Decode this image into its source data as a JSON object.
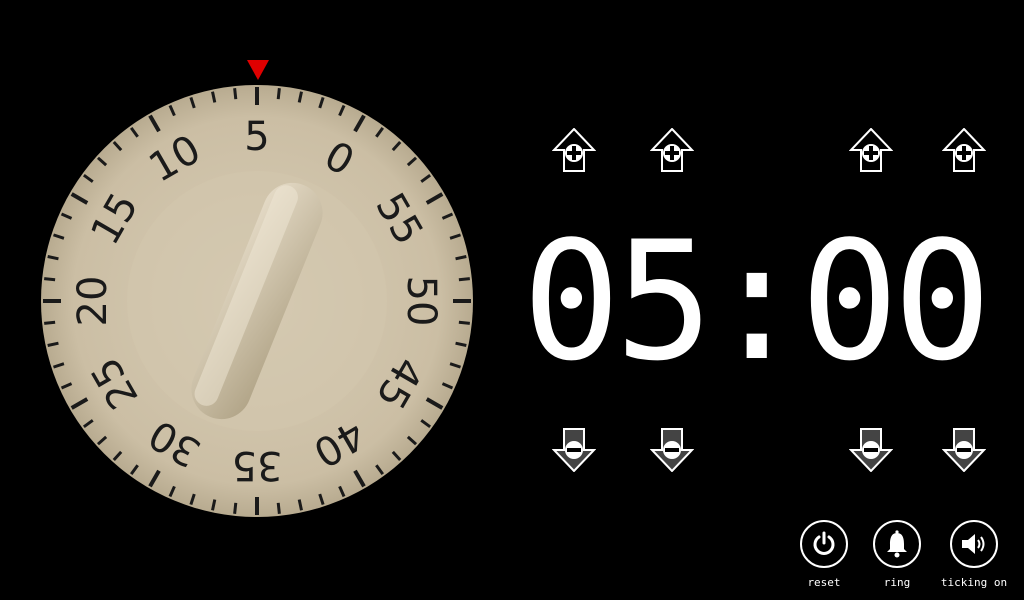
{
  "dial": {
    "labels": [
      "0",
      "5",
      "10",
      "15",
      "20",
      "25",
      "30",
      "35",
      "40",
      "45",
      "50",
      "55"
    ],
    "set_minutes": 5
  },
  "display": {
    "time": "05:00"
  },
  "adjusters": {
    "up": [
      "increment-minute-tens",
      "increment-minute-ones",
      "increment-second-tens",
      "increment-second-ones"
    ],
    "down": [
      "decrement-minute-tens",
      "decrement-minute-ones",
      "decrement-second-tens",
      "decrement-second-ones"
    ]
  },
  "controls": {
    "reset_label": "reset",
    "ring_label": "ring",
    "ticking_label": "ticking on"
  },
  "colors": {
    "pointer": "#e00000",
    "dial_face": "#cfc3ab",
    "dial_ink": "#1a1a1a"
  }
}
